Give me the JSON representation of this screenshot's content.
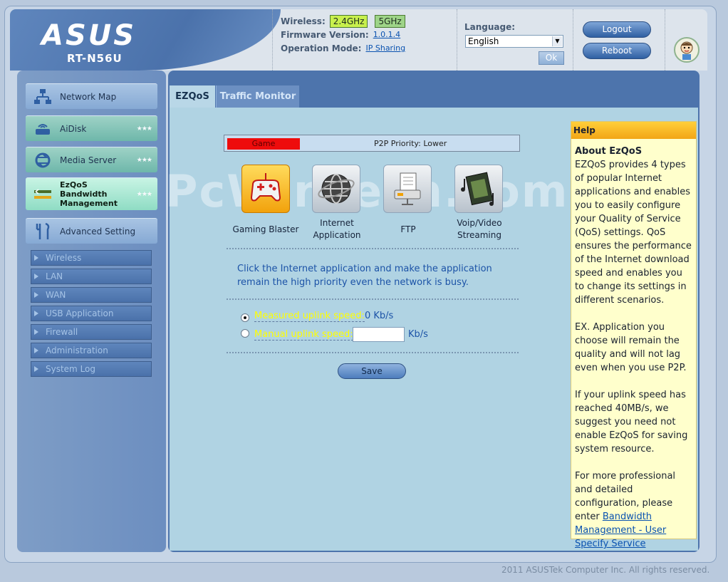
{
  "header": {
    "brand": "ASUS",
    "model": "RT-N56U",
    "wireless_label": "Wireless:",
    "band_24": "2.4GHz",
    "band_5": "5GHz",
    "firmware_label": "Firmware Version:",
    "firmware_value": "1.0.1.4",
    "mode_label": "Operation Mode:",
    "mode_value": "IP Sharing",
    "language_label": "Language:",
    "language_value": "English",
    "ok_label": "Ok",
    "logout_label": "Logout",
    "reboot_label": "Reboot"
  },
  "sidebar": {
    "items": [
      {
        "label": "Network Map"
      },
      {
        "label": "AiDisk"
      },
      {
        "label": "Media Server"
      },
      {
        "label": "EzQoS Bandwidth Management"
      },
      {
        "label": "Advanced Setting"
      }
    ],
    "sub_items": [
      {
        "label": "Wireless"
      },
      {
        "label": "LAN"
      },
      {
        "label": "WAN"
      },
      {
        "label": "USB Application"
      },
      {
        "label": "Firewall"
      },
      {
        "label": "Administration"
      },
      {
        "label": "System Log"
      }
    ]
  },
  "tabs": [
    {
      "label": "EZQoS"
    },
    {
      "label": "Traffic Monitor"
    }
  ],
  "priority": {
    "fill_label": "Game",
    "text": "P2P Priority: Lower",
    "fill_fraction": 0.25
  },
  "apps": [
    {
      "label": "Gaming Blaster",
      "icon": "gamepad-icon",
      "selected": true
    },
    {
      "label": "Internet Application",
      "icon": "globe-icon",
      "selected": false
    },
    {
      "label": "FTP",
      "icon": "ftp-server-icon",
      "selected": false
    },
    {
      "label": "Voip/Video Streaming",
      "icon": "film-music-icon",
      "selected": false
    }
  ],
  "instruction": "Click the Internet application and make the application remain the high priority even the network is busy.",
  "uplink": {
    "measured_label": "Measured uplink speed:",
    "measured_value": "0 Kb/s",
    "manual_label": "Manual uplink speed:",
    "manual_value": "",
    "manual_unit": "Kb/s",
    "selected": "measured"
  },
  "save_label": "Save",
  "help": {
    "title": "Help",
    "heading": "About EzQoS",
    "p1": "EZQoS provides 4 types of popular Internet applications and enables you to easily configure your Quality of Service (QoS) settings. QoS ensures the performance of the Internet download speed and enables you to change its settings in different scenarios.",
    "p2": "EX. Application you choose will remain the quality and will not lag even when you use P2P.",
    "p3": "If your uplink speed has reached 40MB/s, we suggest you need not enable EzQoS for saving system resource.",
    "p4": "For more professional and detailed configuration, please enter",
    "link": "Bandwidth Management - User Specify Service"
  },
  "watermark": "PcWinTech.com",
  "footer": "2011 ASUSTek Computer Inc. All rights reserved.",
  "colors": {
    "accent": "#4d74ac",
    "content_bg": "#b0d3e3",
    "help_bg": "#ffffcc",
    "priority_fill": "#ee0c0c"
  }
}
